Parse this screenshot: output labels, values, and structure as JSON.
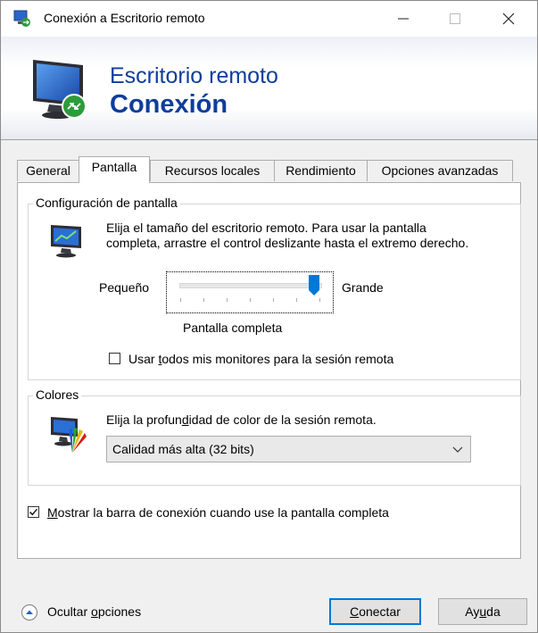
{
  "window": {
    "title": "Conexión a Escritorio remoto",
    "icons": [
      "remote-desktop-icon",
      "minimize-icon",
      "maximize-icon",
      "close-icon"
    ]
  },
  "banner": {
    "line1": "Escritorio remoto",
    "line2": "Conexión",
    "title_color": "#0f3d9c"
  },
  "tabs": [
    {
      "label": "General",
      "active": false
    },
    {
      "label": "Pantalla",
      "active": true
    },
    {
      "label": "Recursos locales",
      "active": false
    },
    {
      "label": "Rendimiento",
      "active": false
    },
    {
      "label": "Opciones avanzadas",
      "active": false
    }
  ],
  "display_group": {
    "title": "Configuración de pantalla",
    "description_line1": "Elija el tamaño del escritorio remoto. Para usar la pantalla",
    "description_line2": "completa, arrastre el control deslizante hasta el extremo derecho.",
    "slider": {
      "min_label": "Pequeño",
      "max_label": "Grande",
      "value_label": "Pantalla completa",
      "position": 1.0
    },
    "all_monitors": {
      "label_before": "Usar ",
      "label_underlined": "t",
      "label_after": "odos mis monitores para la sesión remota",
      "checked": false
    }
  },
  "colors_group": {
    "title": "Colores",
    "description_before": "Elija la profun",
    "description_underlined": "d",
    "description_after": "idad de color de la sesión remota.",
    "selected": "Calidad más alta (32 bits)"
  },
  "connection_bar": {
    "label_underlined": "M",
    "label_after": "ostrar la barra de conexión cuando use la pantalla completa",
    "checked": true
  },
  "footer": {
    "hide_before": "Ocultar ",
    "hide_underlined": "o",
    "hide_after": "pciones",
    "connect_underlined": "C",
    "connect_after": "onectar",
    "help_before": "Ay",
    "help_underlined": "u",
    "help_after": "da"
  },
  "colors": {
    "accent": "#0078d7",
    "banner_text": "#0f3d9c"
  }
}
